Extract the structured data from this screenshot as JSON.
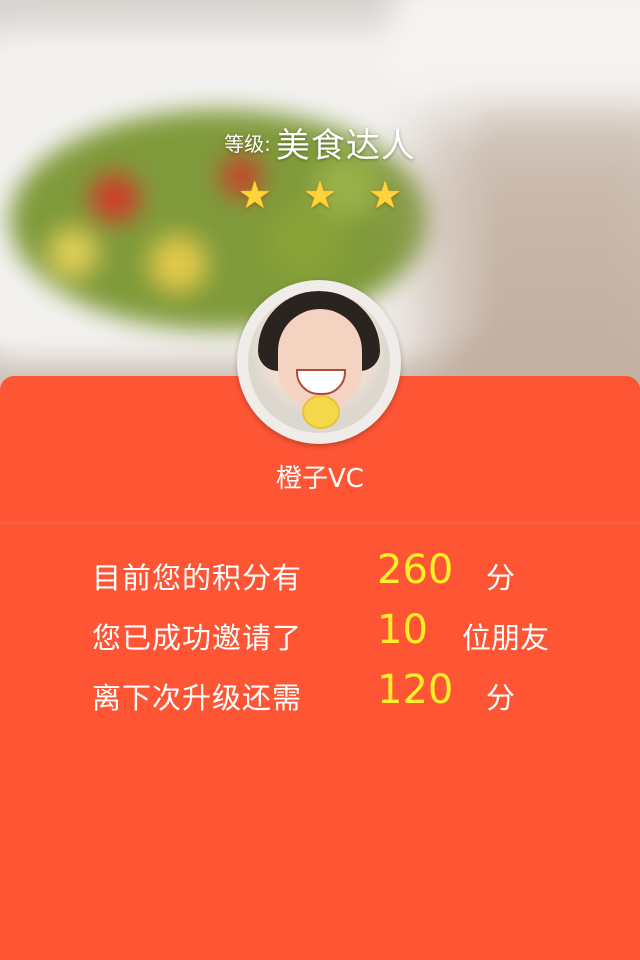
{
  "header": {
    "level_label": "等级:",
    "level_name": "美食达人",
    "stars": [
      "★",
      "★",
      "★"
    ],
    "star_color": "#ffd43a"
  },
  "profile": {
    "username": "橙子VC"
  },
  "stats": [
    {
      "label": "目前您的积分有",
      "value": "260",
      "unit": "分"
    },
    {
      "label": "您已成功邀请了",
      "value": "10",
      "unit": "位朋友"
    },
    {
      "label": "离下次升级还需",
      "value": "120",
      "unit": "分"
    }
  ],
  "colors": {
    "card_background": "#fe5535",
    "value_highlight": "#ffee2a"
  }
}
